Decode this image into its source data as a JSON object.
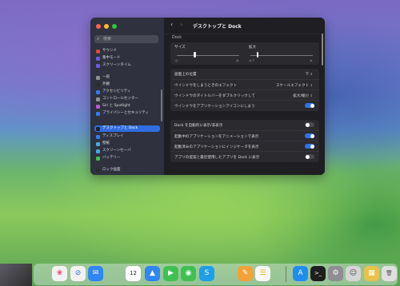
{
  "sidebar": {
    "search_placeholder": "検索",
    "items": [
      {
        "label": "サウンド",
        "color": "#e0453b"
      },
      {
        "label": "集中モード",
        "color": "#6b5ae6"
      },
      {
        "label": "スクリーンタイム",
        "color": "#6b5ae6"
      },
      {
        "label": "一般",
        "color": "#8e8e93"
      },
      {
        "label": "外観",
        "color": "#2b2b2b"
      },
      {
        "label": "アクセシビリティ",
        "color": "#2f7cf6"
      },
      {
        "label": "コントロールセンター",
        "color": "#8e8e93"
      },
      {
        "label": "Siri と Spotlight",
        "color": "#b45ad6"
      },
      {
        "label": "プライバシーとセキュリティ",
        "color": "#2f7cf6"
      },
      {
        "label": "デスクトップと Dock",
        "color": "#1f1f1f"
      },
      {
        "label": "ディスプレイ",
        "color": "#2f7cf6"
      },
      {
        "label": "壁紙",
        "color": "#41a9e8"
      },
      {
        "label": "スクリーンセーバ",
        "color": "#41a9e8"
      },
      {
        "label": "バッテリー",
        "color": "#3fbf4f"
      },
      {
        "label": "ロック画面",
        "color": "#2b2b2b"
      }
    ],
    "active_index": 9
  },
  "window": {
    "title": "デスクトップと Dock"
  },
  "dock_settings": {
    "section_label": "Dock",
    "size_label": "サイズ",
    "size_min": "小",
    "size_max": "大",
    "size_value": 0.27,
    "magnify_label": "拡大",
    "magnify_min": "オフ",
    "magnify_max": "大",
    "magnify_value": 0.1,
    "rows": [
      {
        "label": "画面上の位置",
        "value": "下",
        "type": "select"
      },
      {
        "label": "ウインドウをしまうときのエフェクト",
        "value": "スケールエフェクト",
        "type": "select"
      },
      {
        "label": "ウインドウのタイトルバーをダブルクリックして",
        "value": "拡大/縮小",
        "type": "select"
      },
      {
        "label": "ウインドウをアプリケーションアイコンにしまう",
        "on": true,
        "type": "toggle"
      }
    ],
    "rows2": [
      {
        "label": "Dock を自動的に表示/非表示",
        "on": false
      },
      {
        "label": "起動中のアプリケーションをアニメーションで表示",
        "on": true
      },
      {
        "label": "起動済みのアプリケーションにインジケータを表示",
        "on": true
      },
      {
        "label": "アプリの提案と最近使用したアプリを Dock に表示",
        "on": false
      }
    ]
  },
  "dock": {
    "calendar_day": "12",
    "items": [
      {
        "name": "photos-icon",
        "color": "#f2f2f2",
        "glyph": "❀",
        "glyph_color": "#e2486b"
      },
      {
        "name": "safari-icon",
        "color": "#f2f2f2",
        "glyph": "⊘",
        "glyph_color": "#2f73e8"
      },
      {
        "name": "mail-icon",
        "color": "#2f86f4",
        "glyph": "✉",
        "glyph_color": "#ffffff"
      },
      {
        "name": "calendar-icon",
        "color": "#ffffff",
        "glyph": "12",
        "glyph_color": "#222222"
      },
      {
        "name": "finder-icon",
        "color": "#2f86f4",
        "glyph": "▲",
        "glyph_color": "#ffffff"
      },
      {
        "name": "facetime-icon",
        "color": "#3fc152",
        "glyph": "▶",
        "glyph_color": "#ffffff"
      },
      {
        "name": "messages-icon",
        "color": "#3fc152",
        "glyph": "◉",
        "glyph_color": "#ffffff"
      },
      {
        "name": "skype-icon",
        "color": "#1e9fe8",
        "glyph": "S",
        "glyph_color": "#ffffff"
      },
      {
        "name": "pages-icon",
        "color": "#f3a13a",
        "glyph": "✎",
        "glyph_color": "#ffffff"
      },
      {
        "name": "notes-icon",
        "color": "#f7f7f7",
        "glyph": "☰",
        "glyph_color": "#e0b020"
      },
      {
        "name": "app-store-icon",
        "color": "#1f8cf0",
        "glyph": "A",
        "glyph_color": "#ffffff"
      },
      {
        "name": "terminal-icon",
        "color": "#1e1e1e",
        "glyph": ">_",
        "glyph_color": "#ffffff"
      },
      {
        "name": "system-settings-icon",
        "color": "#8e8e93",
        "glyph": "⚙",
        "glyph_color": "#ffffff"
      },
      {
        "name": "finder-face-icon",
        "color": "#d5d5d5",
        "glyph": "☺",
        "glyph_color": "#444444"
      },
      {
        "name": "launchpad-icon",
        "color": "#e8c24a",
        "glyph": "▦",
        "glyph_color": "#ffffff"
      },
      {
        "name": "trash-icon",
        "color": "#e0e0e0",
        "glyph": "🗑",
        "glyph_color": "#555555"
      }
    ]
  }
}
